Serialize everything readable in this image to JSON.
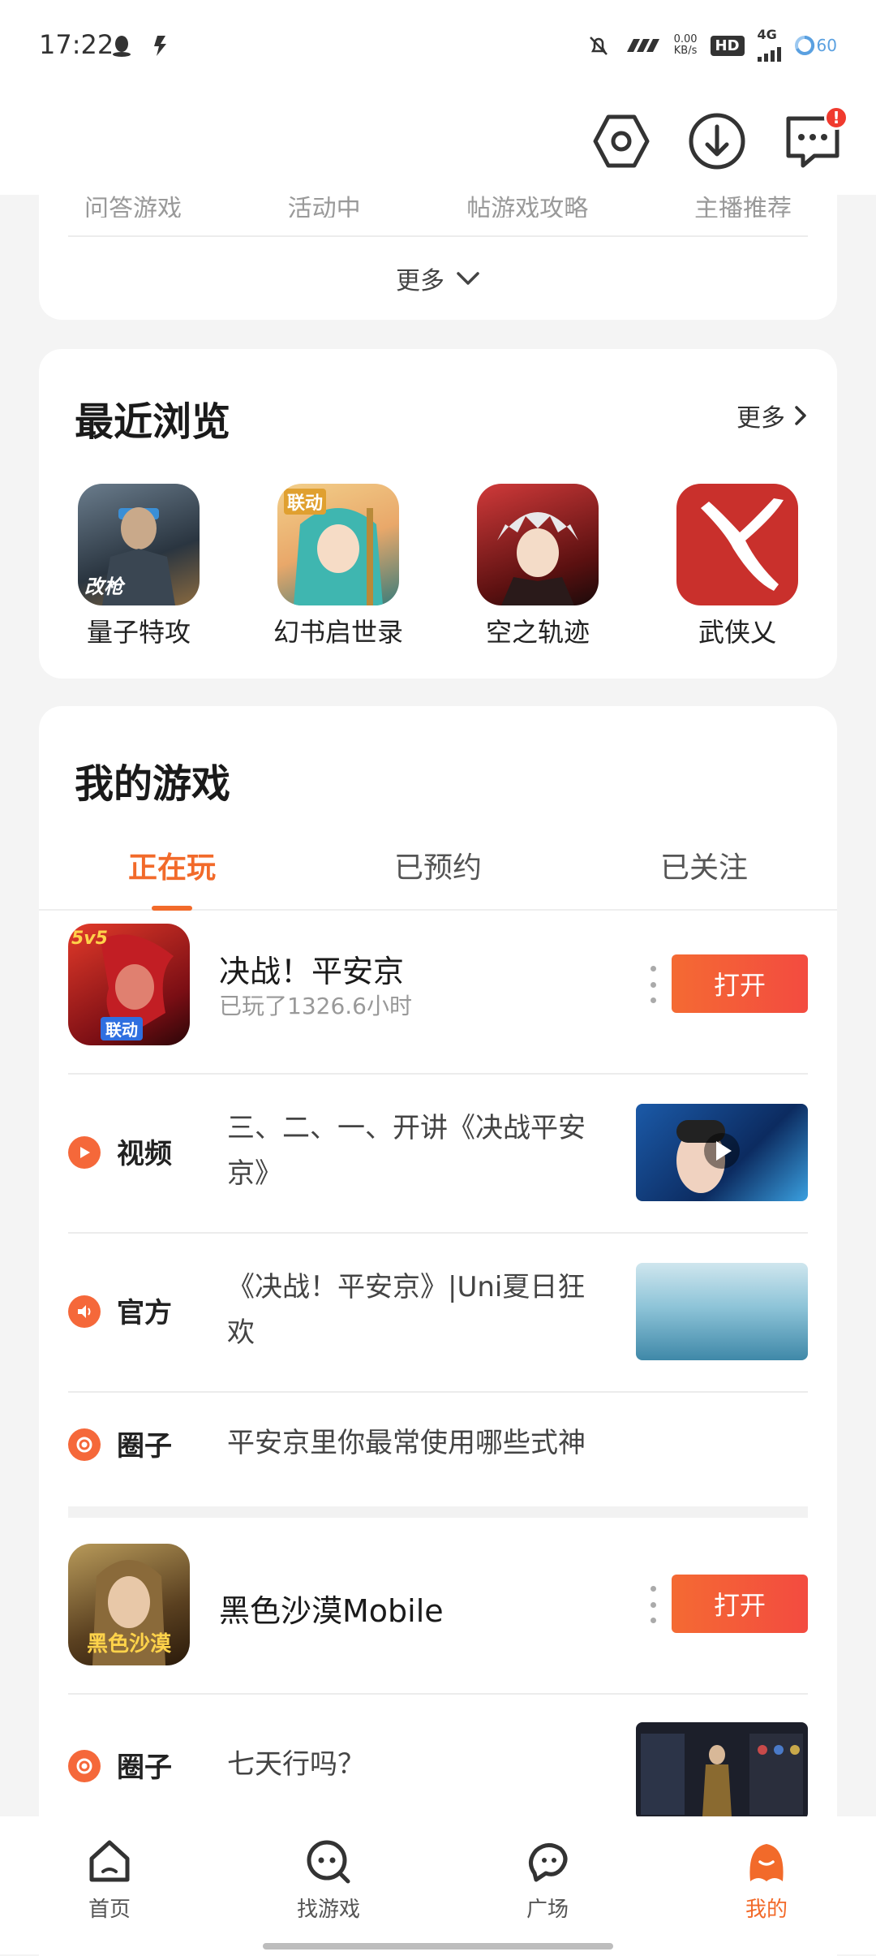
{
  "status_bar": {
    "time": "17:22",
    "net_speed": "0.00",
    "net_unit": "KB/s",
    "hd": "HD",
    "signal": "4G",
    "battery": "60"
  },
  "header": {
    "icons": [
      "settings-icon",
      "download-icon",
      "message-icon"
    ],
    "badge": "!"
  },
  "top_card": {
    "partial_items": [
      "问答游戏",
      "活动中",
      "帖游戏攻略",
      "主播推荐"
    ],
    "more_label": "更多"
  },
  "recent": {
    "title": "最近浏览",
    "more_label": "更多",
    "items": [
      {
        "name": "量子特攻",
        "tag": "改枪"
      },
      {
        "name": "幻书启世录",
        "tag": "联动"
      },
      {
        "name": "空之轨迹",
        "tag": ""
      },
      {
        "name": "武侠乂",
        "tag": ""
      }
    ]
  },
  "my_games": {
    "title": "我的游戏",
    "tabs": [
      "正在玩",
      "已预约",
      "已关注"
    ],
    "active_tab": 0,
    "games": [
      {
        "name": "决战！平安京",
        "subtitle": "已玩了1326.6小时",
        "icon_tag": "联动",
        "icon_badge": "5v5",
        "open_label": "打开",
        "rows": [
          {
            "label": "视频",
            "text": "三、二、一、开讲《决战平安京》",
            "icon": "play-icon"
          },
          {
            "label": "官方",
            "text": "《决战！平安京》|Uni夏日狂欢",
            "icon": "speaker-icon"
          },
          {
            "label": "圈子",
            "text": "平安京里你最常使用哪些式神",
            "icon": "circle-icon"
          }
        ]
      },
      {
        "name": "黑色沙漠Mobile",
        "subtitle": "",
        "icon_tag": "黑色沙漠",
        "open_label": "打开",
        "rows": [
          {
            "label": "圈子",
            "text": "七天行吗？",
            "icon": "circle-icon"
          }
        ]
      }
    ]
  },
  "bottom_nav": {
    "items": [
      "首页",
      "找游戏",
      "广场",
      "我的"
    ],
    "active": 3
  },
  "colors": {
    "accent": "#f26a2a",
    "button_gradient_start": "#f46a33",
    "button_gradient_end": "#f34b40"
  }
}
